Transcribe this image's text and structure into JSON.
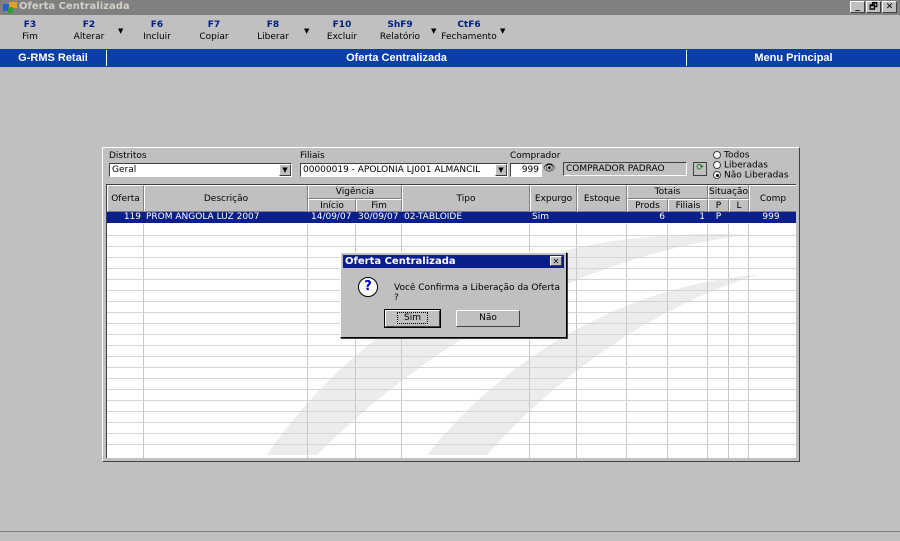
{
  "window": {
    "title": "Oferta Centralizada",
    "controls": [
      "_",
      "🗗",
      "✕"
    ]
  },
  "toolbar": {
    "buttons": [
      {
        "key": "F3",
        "label": "Fim"
      },
      {
        "key": "F2",
        "label": "Alterar"
      },
      {
        "key": "F6",
        "label": "Incluir"
      },
      {
        "key": "F7",
        "label": "Copiar"
      },
      {
        "key": "F8",
        "label": "Liberar"
      },
      {
        "key": "F10",
        "label": "Excluir"
      },
      {
        "key": "ShF9",
        "label": "Relatório"
      },
      {
        "key": "CtF6",
        "label": "Fechamento"
      }
    ]
  },
  "navbar": {
    "left": "G-RMS Retail",
    "center": "Oferta Centralizada",
    "right": "Menu Principal"
  },
  "filters": {
    "distritos_label": "Distritos",
    "distritos_value": "Geral",
    "filiais_label": "Filiais",
    "filiais_value": "00000019 - APOLONIA LJ001 ALMANCIL",
    "comprador_label": "Comprador",
    "comprador_code": "999",
    "comprador_name": "COMPRADOR PADRAO",
    "radio": {
      "todos": "Todos",
      "liberadas": "Liberadas",
      "nao_liberadas": "Não Liberadas"
    }
  },
  "grid": {
    "headers": {
      "oferta": "Oferta",
      "descricao": "Descrição",
      "vigencia": "Vigência",
      "inicio": "Início",
      "fim": "Fim",
      "tipo": "Tipo",
      "expurgo": "Expurgo",
      "estoque": "Estoque",
      "totais": "Totais",
      "prods": "Prods",
      "filiais": "Filiais",
      "situacao": "Situação",
      "p": "P",
      "l": "L",
      "comp": "Comp"
    },
    "rows": [
      {
        "oferta": "119",
        "descricao": "PROM ANGOLA LUZ 2007",
        "inicio": "14/09/07",
        "fim": "30/09/07",
        "tipo": "02-TABLOIDE",
        "expurgo": "Sim",
        "estoque": "",
        "prods": "6",
        "filiais": "1",
        "p": "P",
        "l": "",
        "comp": "999"
      }
    ]
  },
  "dialog": {
    "title": "Oferta Centralizada",
    "message": "Você Confirma a Liberação da Oferta ?",
    "yes": "Sim",
    "no": "Não",
    "icon": "question-icon"
  }
}
